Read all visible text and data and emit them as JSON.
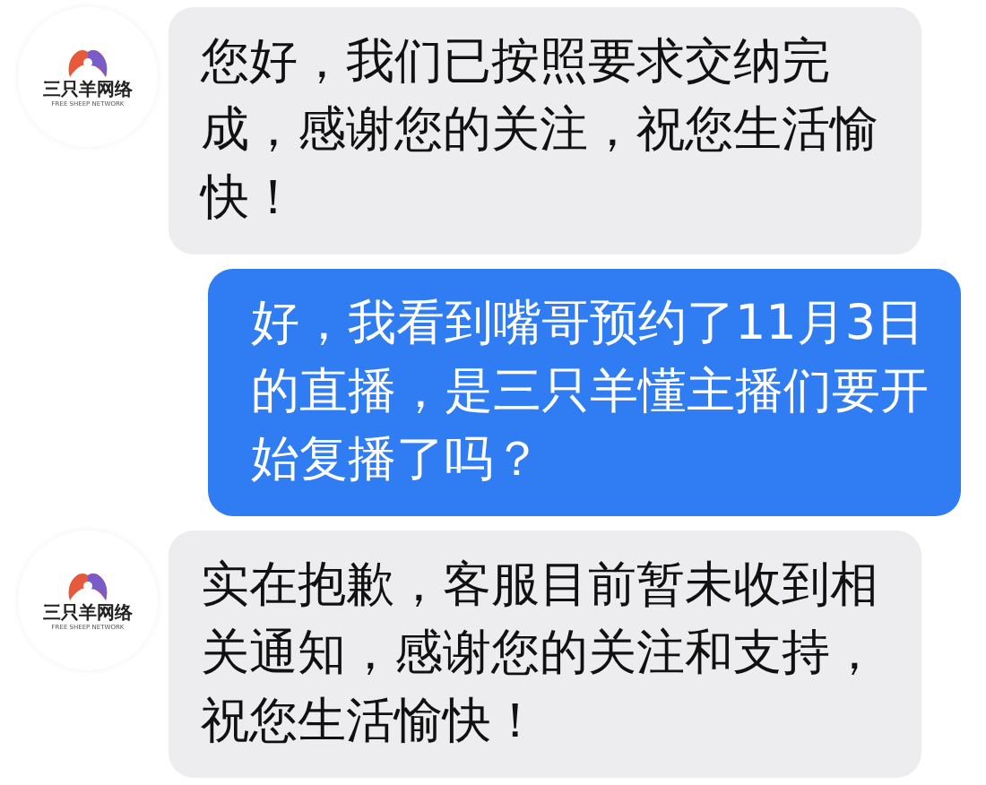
{
  "messages": [
    {
      "kind": "incoming",
      "avatar": {
        "name": "三只羊网络",
        "tagline": "FREE SHEEP NETWORK"
      },
      "text": "您好，我们已按照要求交纳完成，感谢您的关注，祝您生活愉快！"
    },
    {
      "kind": "outgoing",
      "text": "好，我看到嘴哥预约了11月3日的直播，是三只羊懂主播们要开始复播了吗？"
    },
    {
      "kind": "incoming",
      "avatar": {
        "name": "三只羊网络",
        "tagline": "FREE SHEEP NETWORK"
      },
      "text": "实在抱歉，客服目前暂未收到相关通知，感谢您的关注和支持，祝您生活愉快！"
    }
  ]
}
